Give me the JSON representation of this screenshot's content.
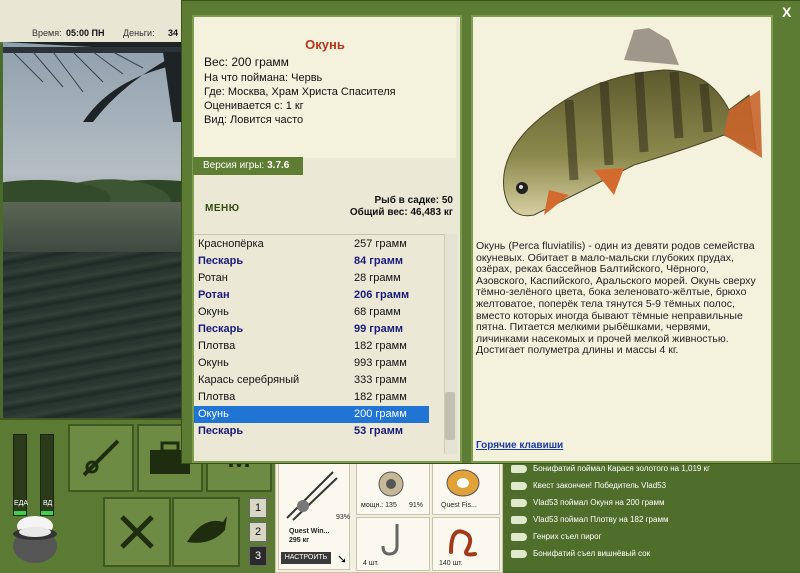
{
  "status_bar": {
    "time_label": "Время:",
    "time_value": "05:00 ПН",
    "money_label": "Деньги:",
    "money_value": "34"
  },
  "dialog": {
    "close_label": "X",
    "fish": {
      "name": "Окунь",
      "weight_line": "Вес: 200 грамм",
      "caught_with": "На что поймана: Червь",
      "location": "Где: Москва, Храм Христа Спасителя",
      "price": "Оценивается с: 1 кг",
      "species_note": "Вид: Ловится часто"
    },
    "version_label": "Версия игры: ",
    "version_value": "3.7.6",
    "menu_label": "МЕНЮ",
    "keepnet": {
      "count": "Рыб в садке: 50",
      "total_weight": "Общий вес: 46,483 кг"
    },
    "catch_list": [
      {
        "name": "Краснопёрка",
        "weight": "257 грамм",
        "bold": false
      },
      {
        "name": "Пескарь",
        "weight": "84 грамм",
        "bold": true
      },
      {
        "name": "Ротан",
        "weight": "28 грамм",
        "bold": false
      },
      {
        "name": "Ротан",
        "weight": "206 грамм",
        "bold": true
      },
      {
        "name": "Окунь",
        "weight": "68 грамм",
        "bold": false
      },
      {
        "name": "Пескарь",
        "weight": "99 грамм",
        "bold": true
      },
      {
        "name": "Плотва",
        "weight": "182 грамм",
        "bold": false
      },
      {
        "name": "Окунь",
        "weight": "993 грамм",
        "bold": false
      },
      {
        "name": "Карась серебряный",
        "weight": "333 грамм",
        "bold": false
      },
      {
        "name": "Плотва",
        "weight": "182 грамм",
        "bold": false
      },
      {
        "name": "Окунь",
        "weight": "200 грамм",
        "bold": false,
        "selected": true
      },
      {
        "name": "Пескарь",
        "weight": "53 грамм",
        "bold": true
      }
    ],
    "description": "Окунь (Perca fluviatilis) - один из девяти родов семейства окуневых. Обитает в мало-мальски глубоких прудах, озёрах, реках бассейнов Балтийского, Чёрного, Азовского, Каспийского, Аральского морей. Окунь сверху тёмно-зелёного цвета, бока зеленовато-жёлтые, брюхо желтоватое, поперёк тела тянутся 5-9 тёмных полос, вместо которых иногда бывают тёмные неправильные пятна. Питается мелкими рыбёшками, червями, личинками насекомых и прочей мелкой живностью. Достигает полуметра длины и массы 4 кг.",
    "hotkeys_label": "Горячие клавиши"
  },
  "hud": {
    "food_label": "ЕДА",
    "water_label": "ВД",
    "food_level": 0.05,
    "water_level": 0.05,
    "page_buttons": [
      "1",
      "2",
      "3"
    ],
    "rod_name": "Quest Win...",
    "rod_weight": "295 кг",
    "rod_durability": "93%",
    "setup_label": "НАСТРОИТЬ",
    "reel_label": "мощн.: 135",
    "reel_percent": "91%",
    "line_label": "Quest Fis...",
    "hook_count": "4 шт.",
    "bait_count": "140 шт."
  },
  "chat": [
    "Бонифатий поймал Карася золотого на 1,019 кг",
    "Квест закончен! Победитель Vlad53",
    "Vlad53 поймал Окуня на 200 грамм",
    "Vlad53 поймал Плотву на 182 грамм",
    "Генрих съел пирог",
    "Бонифатий съел вишнёвый сок"
  ],
  "colors": {
    "accent_green": "#5d7c33",
    "title_red": "#b5361b",
    "selected_blue": "#1f74d4",
    "link_blue": "#1a3aa8"
  }
}
